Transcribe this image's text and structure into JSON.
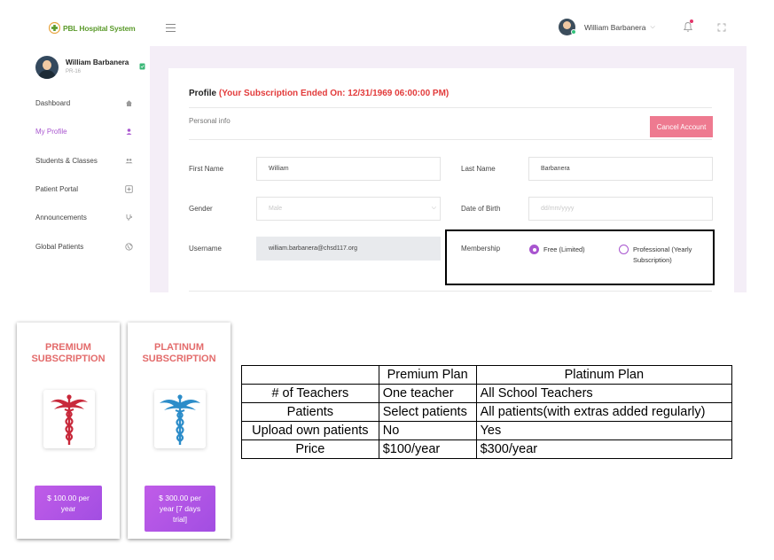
{
  "app": {
    "logo_text": "PBL Hospital System",
    "user_name": "William Barbanera"
  },
  "sidebar": {
    "profile": {
      "name": "William Barbanera",
      "id": "PR-16"
    },
    "items": [
      {
        "label": "Dashboard",
        "icon": "home-icon",
        "active": false
      },
      {
        "label": "My Profile",
        "icon": "user-icon",
        "active": true
      },
      {
        "label": "Students & Classes",
        "icon": "users-icon",
        "active": false
      },
      {
        "label": "Patient Portal",
        "icon": "medical-plus-icon",
        "active": false
      },
      {
        "label": "Announcements",
        "icon": "stethoscope-icon",
        "active": false
      },
      {
        "label": "Global Patients",
        "icon": "globe-icon",
        "active": false
      }
    ],
    "active_color": "#a855cf"
  },
  "profile": {
    "title": "Profile",
    "subscription_notice": "(Your Subscription Ended On: 12/31/1969 06:00:00 PM)",
    "section_label": "Personal info",
    "cancel_label": "Cancel Account",
    "fields": {
      "first_name": {
        "label": "First Name",
        "value": "William"
      },
      "last_name": {
        "label": "Last Name",
        "value": "Barbanera"
      },
      "gender": {
        "label": "Gender",
        "value": "Male"
      },
      "dob": {
        "label": "Date of Birth",
        "placeholder": "dd/mm/yyyy"
      },
      "username": {
        "label": "Username",
        "value": "william.barbanera@chsd117.org"
      },
      "membership": {
        "label": "Membership",
        "options": [
          {
            "label": "Free (Limited)",
            "checked": true
          },
          {
            "label": "Professional (Yearly Subscription)",
            "checked": false
          }
        ]
      }
    },
    "warn_color": "#e23b3b",
    "button_color": "#ee7a90"
  },
  "subscriptions": [
    {
      "title": "PREMIUM SUBSCRIPTION",
      "price": "$ 100.00 per year",
      "icon": "caduceus-red-icon"
    },
    {
      "title": "PLATINUM SUBSCRIPTION",
      "price": "$ 300.00 per year [7 days trial]",
      "icon": "caduceus-blue-icon"
    }
  ],
  "comparison": {
    "headers": [
      "",
      "Premium Plan",
      "Platinum Plan"
    ],
    "rows": [
      [
        "# of Teachers",
        "One teacher",
        "All School Teachers"
      ],
      [
        "Patients",
        "Select patients",
        "All patients(with extras added regularly)"
      ],
      [
        "Upload own patients",
        "No",
        "Yes"
      ],
      [
        "Price",
        "$100/year",
        "$300/year"
      ]
    ]
  }
}
